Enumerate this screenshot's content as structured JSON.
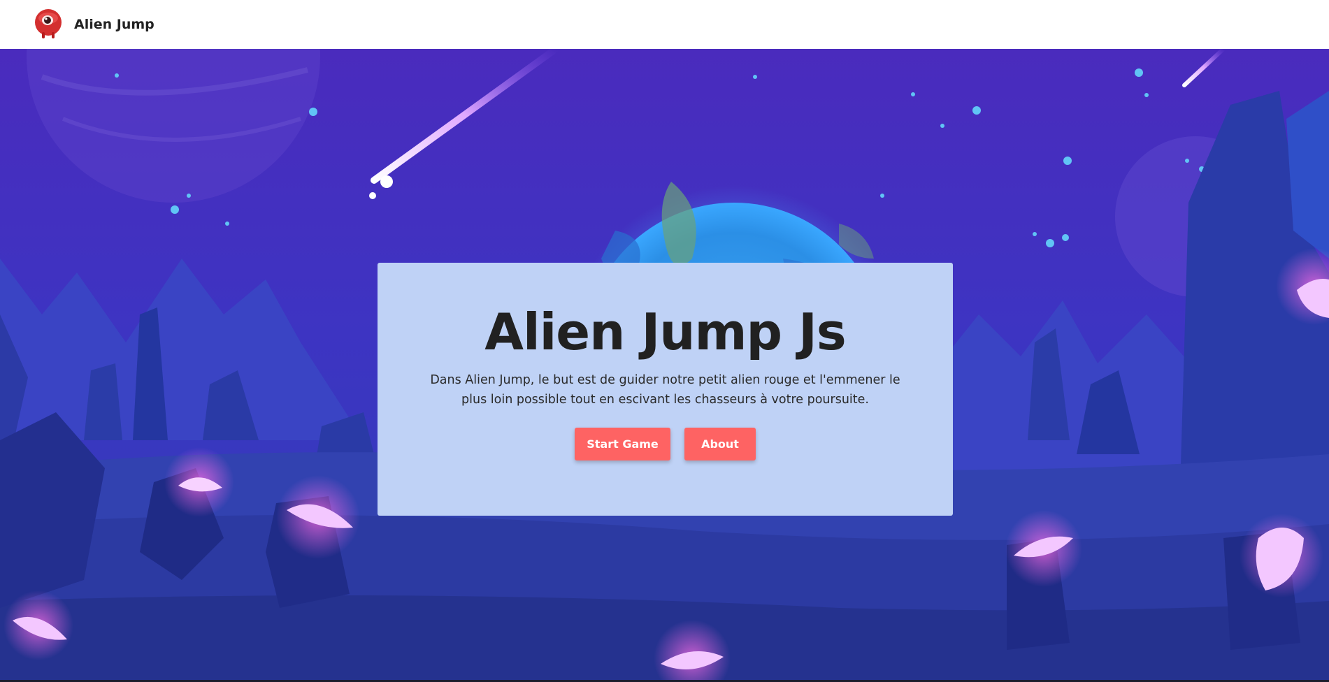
{
  "navbar": {
    "brand_name": "Alien Jump",
    "logo_icon": "red-alien-icon"
  },
  "hero": {
    "title": "Alien Jump Js",
    "description": "Dans Alien Jump, le but est de guider notre petit alien rouge et l'emmener le plus loin possible tout en escivant les chasseurs à votre poursuite.",
    "buttons": {
      "start_label": "Start Game",
      "about_label": "About"
    }
  },
  "colors": {
    "accent": "#fe6363",
    "card_background": "#bfd2f6",
    "sky_top": "#4a2bbd",
    "sky_bottom": "#2e3fb8",
    "planet": "#2f8be6",
    "text_dark": "#212121"
  }
}
